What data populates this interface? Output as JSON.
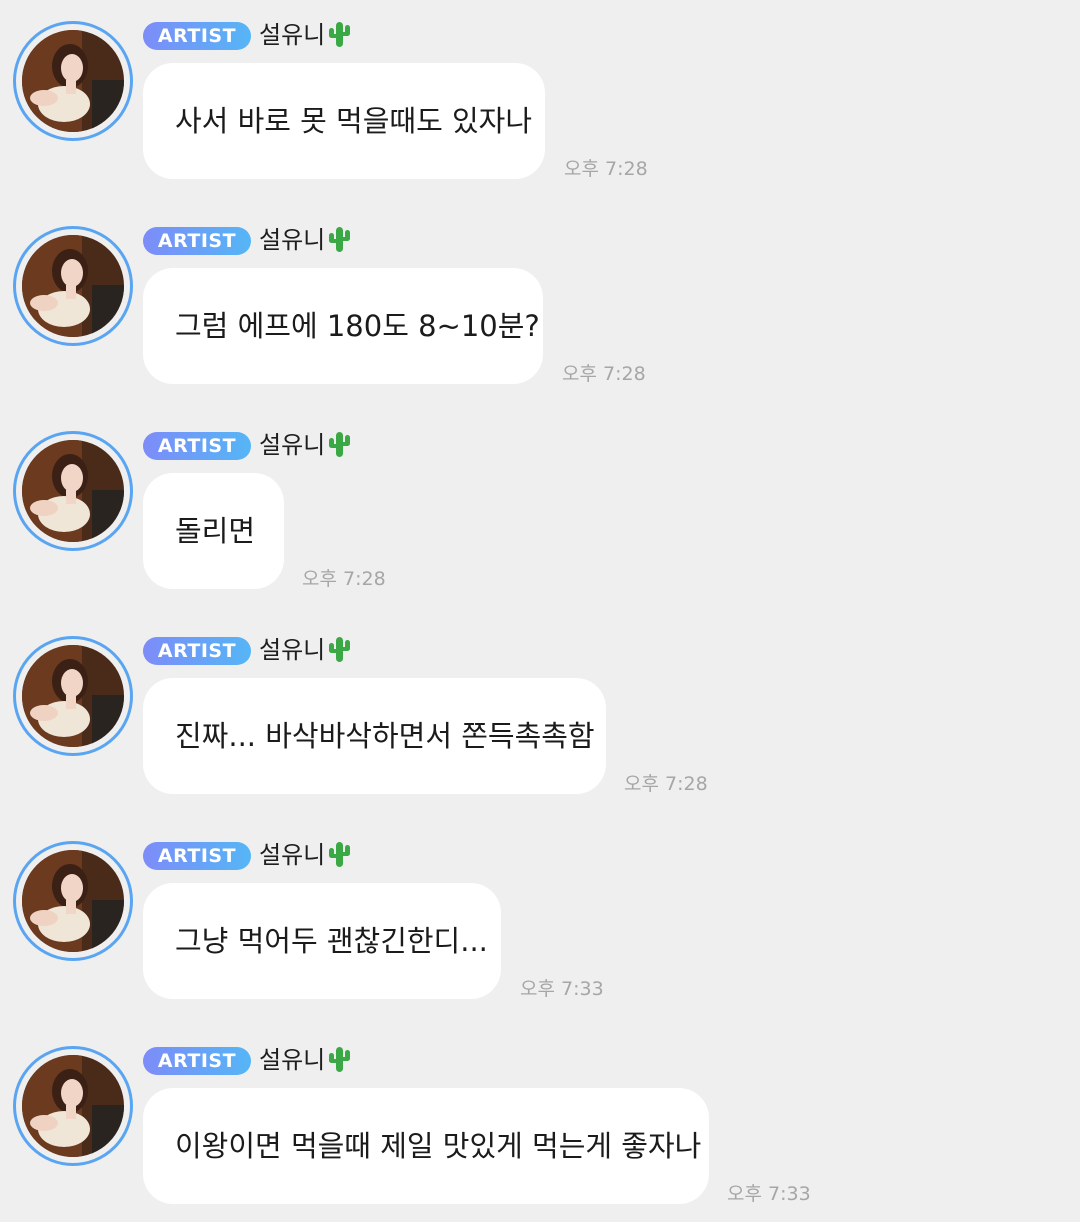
{
  "colors": {
    "background": "#efefef",
    "bubble": "#ffffff",
    "avatar_ring": "#5aa5f2",
    "badge_gradient_start": "#7d8cf8",
    "badge_gradient_end": "#55b6f6",
    "timestamp": "#a6a6a6"
  },
  "messages": [
    {
      "badge": "ARTIST",
      "sender": "설유니",
      "sender_emoji": "cactus-icon",
      "text": "사서 바로 못 먹을때도 있자나",
      "time": "오후 7:28"
    },
    {
      "badge": "ARTIST",
      "sender": "설유니",
      "sender_emoji": "cactus-icon",
      "text": "그럼 에프에 180도 8~10분?",
      "time": "오후 7:28"
    },
    {
      "badge": "ARTIST",
      "sender": "설유니",
      "sender_emoji": "cactus-icon",
      "text": "돌리면",
      "time": "오후 7:28"
    },
    {
      "badge": "ARTIST",
      "sender": "설유니",
      "sender_emoji": "cactus-icon",
      "text": "진짜... 바삭바삭하면서 쫀득촉촉함",
      "time": "오후 7:28"
    },
    {
      "badge": "ARTIST",
      "sender": "설유니",
      "sender_emoji": "cactus-icon",
      "text": "그냥 먹어두 괜찮긴한디...",
      "time": "오후 7:33"
    },
    {
      "badge": "ARTIST",
      "sender": "설유니",
      "sender_emoji": "cactus-icon",
      "text": "이왕이면 먹을때 제일 맛있게 먹는게 좋자나",
      "time": "오후 7:33"
    }
  ]
}
